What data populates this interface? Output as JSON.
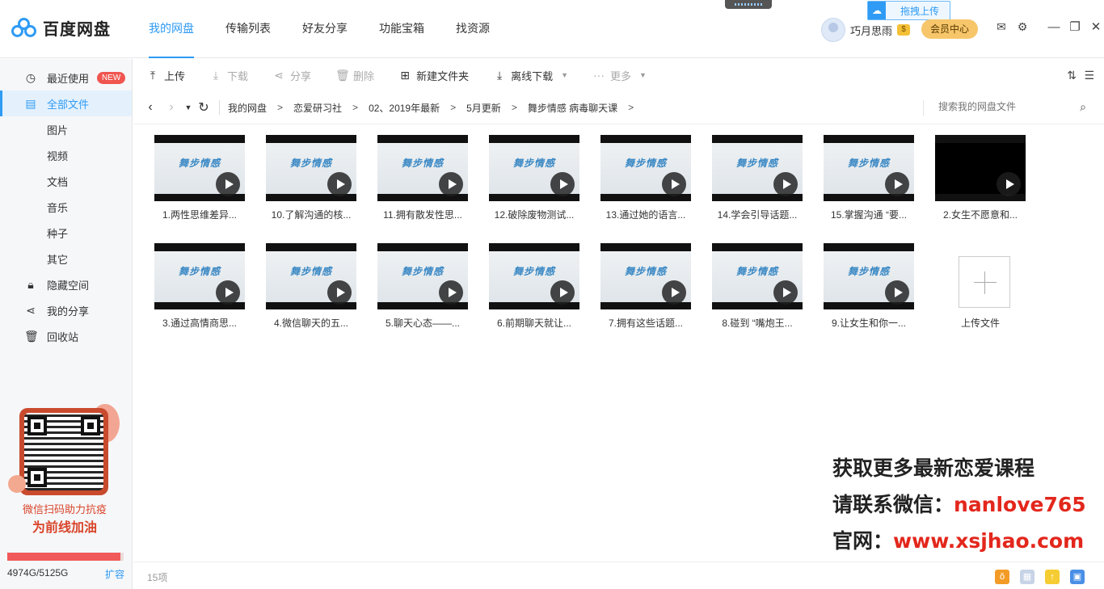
{
  "app": {
    "logo_text": "百度网盘",
    "drag_upload": "拖拽上传"
  },
  "nav": [
    {
      "label": "我的网盘",
      "active": true
    },
    {
      "label": "传输列表",
      "active": false
    },
    {
      "label": "好友分享",
      "active": false
    },
    {
      "label": "功能宝箱",
      "active": false
    },
    {
      "label": "找资源",
      "active": false
    }
  ],
  "user": {
    "name": "巧月思雨",
    "vip_badge": "$",
    "vip_button": "会员中心"
  },
  "sidebar": {
    "items": [
      {
        "label": "最近使用",
        "badge": "NEW",
        "icon": "clock-icon"
      },
      {
        "label": "全部文件",
        "icon": "document-icon",
        "active": true
      },
      {
        "label": "图片"
      },
      {
        "label": "视频"
      },
      {
        "label": "文档"
      },
      {
        "label": "音乐"
      },
      {
        "label": "种子"
      },
      {
        "label": "其它"
      },
      {
        "label": "隐藏空间",
        "icon": "lock-icon"
      },
      {
        "label": "我的分享",
        "icon": "share-icon"
      },
      {
        "label": "回收站",
        "icon": "trash-icon"
      }
    ],
    "promo_line1": "微信扫码助力抗疫",
    "promo_line2": "为前线加油",
    "quota_text": "4974G/5125G",
    "quota_used_fraction": 0.9705,
    "expand": "扩容"
  },
  "toolbar": {
    "upload": "上传",
    "download": "下载",
    "share": "分享",
    "delete": "删除",
    "new_folder": "新建文件夹",
    "offline_download": "离线下载",
    "more": "更多"
  },
  "breadcrumb": [
    "我的网盘",
    "恋爱研习社",
    "02、2019年最新",
    "5月更新",
    "舞步情感 病毒聊天课"
  ],
  "search": {
    "placeholder": "搜索我的网盘文件"
  },
  "thumb_brand": "舞步情感",
  "files": [
    {
      "name": "1.两性思维差异...",
      "thumb": "video"
    },
    {
      "name": "10.了解沟通的核...",
      "thumb": "video"
    },
    {
      "name": "11.拥有散发性思...",
      "thumb": "video"
    },
    {
      "name": "12.破除废物测试...",
      "thumb": "video"
    },
    {
      "name": "13.通过她的语言...",
      "thumb": "video"
    },
    {
      "name": "14.学会引导话题...",
      "thumb": "video"
    },
    {
      "name": "15.掌握沟通 “要...",
      "thumb": "video"
    },
    {
      "name": "2.女生不愿意和...",
      "thumb": "black"
    },
    {
      "name": "3.通过高情商思...",
      "thumb": "video"
    },
    {
      "name": "4.微信聊天的五...",
      "thumb": "video"
    },
    {
      "name": "5.聊天心态——...",
      "thumb": "video"
    },
    {
      "name": "6.前期聊天就让...",
      "thumb": "video"
    },
    {
      "name": "7.拥有这些话题...",
      "thumb": "video"
    },
    {
      "name": "8.碰到 “嘴炮王...",
      "thumb": "video"
    },
    {
      "name": "9.让女生和你一...",
      "thumb": "video"
    }
  ],
  "upload_tile_label": "上传文件",
  "watermark": {
    "line1": "获取更多最新恋爱课程",
    "line2_prefix": "请联系微信：",
    "line2_value": "nanlove765",
    "line3_prefix": "官网：",
    "line3_value": "www.xsjhao.com"
  },
  "status": {
    "item_count": "15项"
  },
  "colors": {
    "accent": "#2f9bf4",
    "watermark_red": "#e3271c",
    "new_badge": "#f0554f",
    "vip_gold": "#f7c66b"
  }
}
